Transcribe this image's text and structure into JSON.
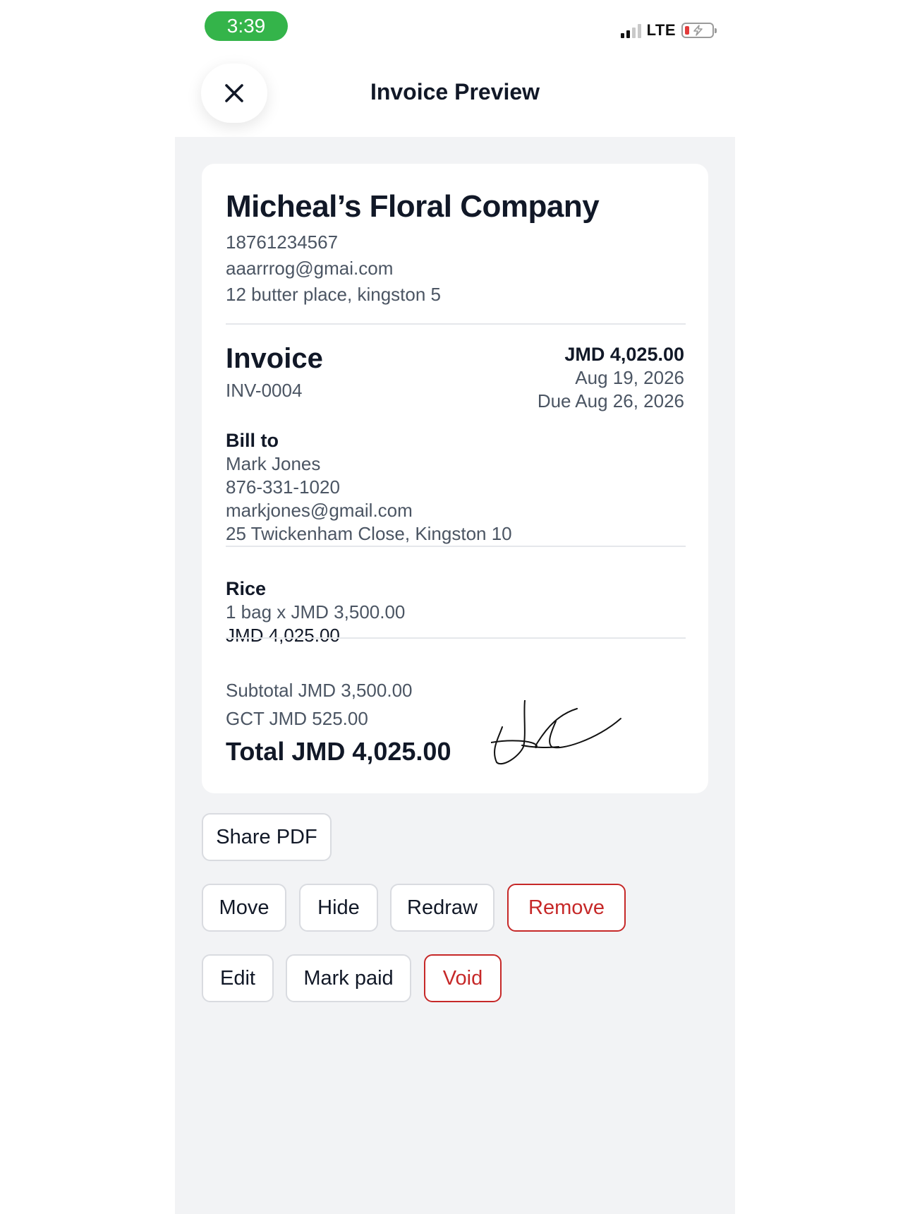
{
  "status_bar": {
    "time": "3:39",
    "network": "LTE"
  },
  "header": {
    "title": "Invoice Preview",
    "close_icon": "close-icon"
  },
  "business": {
    "name": "Micheal’s Floral Company",
    "phone": "18761234567",
    "email": "aaarrrog@gmai.com",
    "address": "12 butter place, kingston 5"
  },
  "invoice": {
    "label": "Invoice",
    "number": "INV-0004",
    "amount": "JMD 4,025.00",
    "date": "Aug 19, 2026",
    "due": "Due Aug 26, 2026"
  },
  "bill_to": {
    "label": "Bill to",
    "name": "Mark Jones",
    "phone": "876-331-1020",
    "email": "markjones@gmail.com",
    "address": "25 Twickenham Close, Kingston 10"
  },
  "items": [
    {
      "name": "Rice",
      "detail": "1 bag x JMD 3,500.00",
      "total": "JMD 4,025.00"
    }
  ],
  "totals": {
    "subtotal": "Subtotal JMD 3,500.00",
    "gct": "GCT JMD 525.00",
    "total": "Total JMD 4,025.00"
  },
  "actions": {
    "share_pdf": "Share PDF",
    "move": "Move",
    "hide": "Hide",
    "redraw": "Redraw",
    "remove": "Remove",
    "edit": "Edit",
    "mark_paid": "Mark paid",
    "void": "Void"
  },
  "colors": {
    "time_pill": "#34b44a",
    "danger": "#c62828",
    "background": "#f2f3f5"
  }
}
